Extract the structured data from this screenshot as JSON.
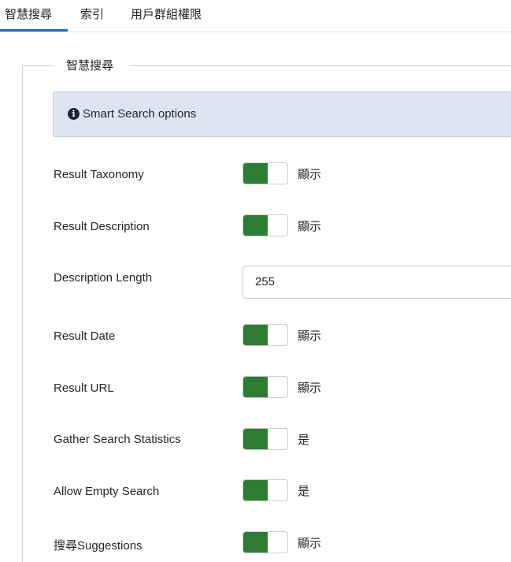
{
  "tabs": [
    {
      "label": "智慧搜尋",
      "active": true
    },
    {
      "label": "索引",
      "active": false
    },
    {
      "label": "用戶群組權限",
      "active": false
    }
  ],
  "fieldset": {
    "legend": "智慧搜尋"
  },
  "alert": {
    "icon": "info-icon",
    "text": "Smart Search options"
  },
  "fields": {
    "result_taxonomy": {
      "label": "Result Taxonomy",
      "state": "顯示",
      "on": true
    },
    "result_description": {
      "label": "Result Description",
      "state": "顯示",
      "on": true
    },
    "description_length": {
      "label": "Description Length",
      "value": "255"
    },
    "result_date": {
      "label": "Result Date",
      "state": "顯示",
      "on": true
    },
    "result_url": {
      "label": "Result URL",
      "state": "顯示",
      "on": true
    },
    "gather_stats": {
      "label": "Gather Search Statistics",
      "state": "是",
      "on": true
    },
    "allow_empty": {
      "label": "Allow Empty Search",
      "state": "是",
      "on": true
    },
    "suggestions": {
      "label": "搜尋Suggestions",
      "state": "顯示",
      "on": true
    }
  },
  "colors": {
    "toggle_on": "#2e7c32",
    "tab_accent": "#2a69b8",
    "alert_bg": "#dde5f0"
  }
}
